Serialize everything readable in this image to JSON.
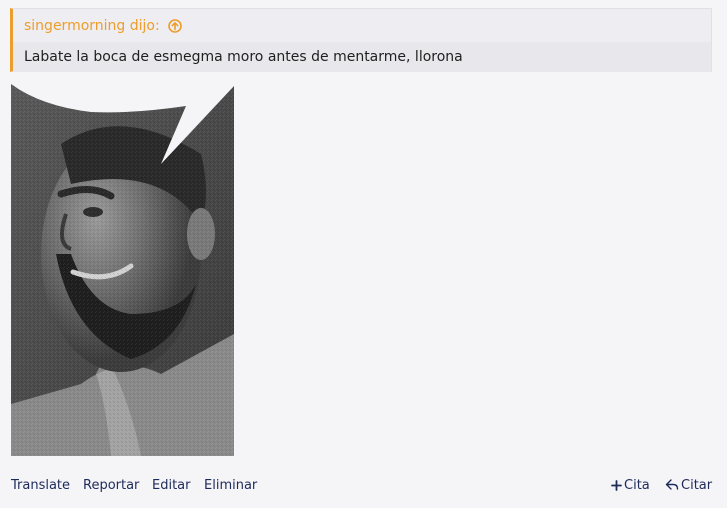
{
  "quote": {
    "author": "singermorning dijo:",
    "text": "Labate la boca de esmegma moro antes de mentarme, llorona"
  },
  "footer": {
    "translate": "Translate",
    "report": "Reportar",
    "edit": "Editar",
    "delete": "Eliminar",
    "quote_multi": "Cita",
    "reply": "Citar"
  },
  "colors": {
    "accent": "#ed9d2b",
    "link": "#1e2a5a"
  }
}
